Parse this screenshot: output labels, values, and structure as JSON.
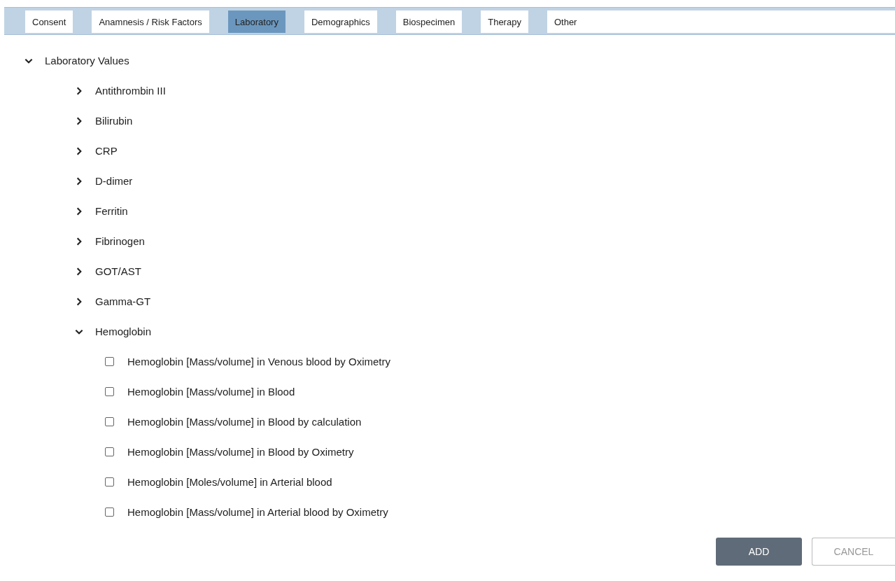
{
  "tabs": [
    {
      "label": "Consent",
      "selected": false
    },
    {
      "label": "Anamnesis / Risk Factors",
      "selected": false
    },
    {
      "label": "Laboratory",
      "selected": true
    },
    {
      "label": "Demographics",
      "selected": false
    },
    {
      "label": "Biospecimen",
      "selected": false
    },
    {
      "label": "Therapy",
      "selected": false
    },
    {
      "label": "Other",
      "selected": false
    }
  ],
  "tree": {
    "label": "Laboratory Values",
    "expanded": true,
    "children": [
      {
        "label": "Antithrombin III",
        "expanded": false
      },
      {
        "label": "Bilirubin",
        "expanded": false
      },
      {
        "label": "CRP",
        "expanded": false
      },
      {
        "label": "D-dimer",
        "expanded": false
      },
      {
        "label": "Ferritin",
        "expanded": false
      },
      {
        "label": "Fibrinogen",
        "expanded": false
      },
      {
        "label": "GOT/AST",
        "expanded": false
      },
      {
        "label": "Gamma-GT",
        "expanded": false
      },
      {
        "label": "Hemoglobin",
        "expanded": true,
        "children": [
          {
            "label": "Hemoglobin [Mass/volume] in Venous blood by Oximetry",
            "checked": false
          },
          {
            "label": "Hemoglobin [Mass/volume] in Blood",
            "checked": false
          },
          {
            "label": "Hemoglobin [Mass/volume] in Blood by calculation",
            "checked": false
          },
          {
            "label": "Hemoglobin [Mass/volume] in Blood by Oximetry",
            "checked": false
          },
          {
            "label": "Hemoglobin [Moles/volume] in Arterial blood",
            "checked": false
          },
          {
            "label": "Hemoglobin [Mass/volume] in Arterial blood by Oximetry",
            "checked": false
          }
        ]
      }
    ]
  },
  "buttons": {
    "add": "ADD",
    "cancel": "CANCEL"
  }
}
